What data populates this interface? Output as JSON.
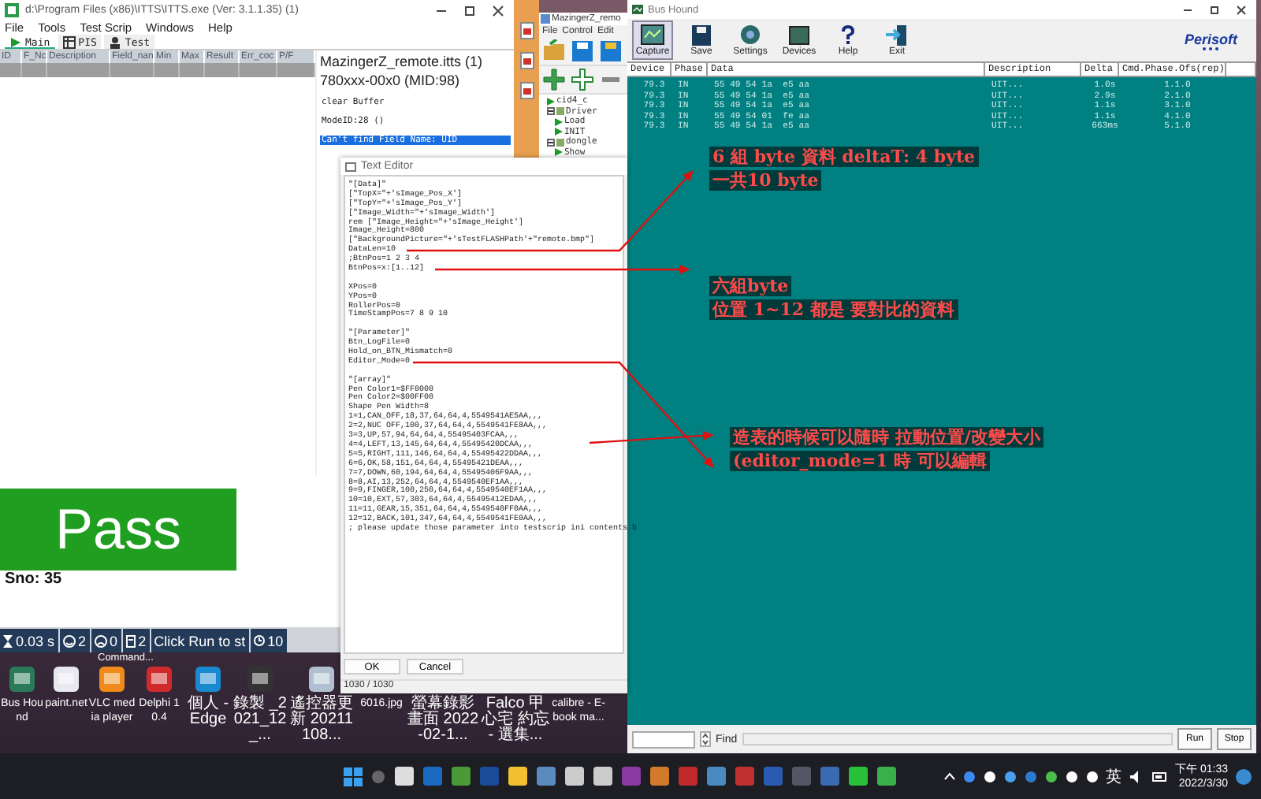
{
  "itts": {
    "title": "d:\\Program Files (x86)\\ITTS\\ITTS.exe    (Ver: 3.1.1.35) (1)",
    "menu": [
      "File",
      "Tools",
      "Test Scrip",
      "Windows",
      "Help"
    ],
    "tabs": [
      {
        "label": "Main",
        "selected": true
      },
      {
        "label": "PIS",
        "selected": false
      },
      {
        "label": "Test",
        "selected": false
      }
    ],
    "columns": [
      "ID",
      "F_Nc",
      "Description",
      "Field_nan",
      "Min",
      "Max",
      "Result",
      "Err_coc",
      "P/F"
    ],
    "script_title": "MazingerZ_remote.itts  (1)",
    "model": "780xxx-00x0 (MID:98)",
    "log": [
      {
        "text": "clear Buffer",
        "selected": false
      },
      {
        "text": "ModeID:28 ()",
        "selected": false
      },
      {
        "text": "Can't find Field Name: UID",
        "selected": true
      }
    ],
    "result": "Pass",
    "serial": "Sno: 35",
    "status": [
      {
        "kind": "timer",
        "text": "0.03 s"
      },
      {
        "kind": "smile",
        "text": "2"
      },
      {
        "kind": "frown",
        "text": "0"
      },
      {
        "kind": "doc",
        "text": "2"
      },
      {
        "kind": "plain",
        "text": "Click Run to st"
      },
      {
        "kind": "clock",
        "text": "10"
      }
    ]
  },
  "mazinger": {
    "title": "MazingerZ_remo",
    "menu": [
      "File",
      "Control",
      "Edit"
    ],
    "tree": [
      {
        "label": "cid4_c"
      },
      {
        "label": "Driver",
        "children": [
          {
            "label": "Load"
          },
          {
            "label": "INIT"
          }
        ]
      },
      {
        "label": "dongle",
        "children": [
          {
            "label": "Show"
          }
        ]
      }
    ]
  },
  "text_editor": {
    "title": "Text Editor",
    "sections": [
      [
        "\"[Data]\"",
        "[\"TopX=\"+'sImage_Pos_X']",
        "[\"TopY=\"+'sImage_Pos_Y']",
        "[\"Image_Width=\"+'sImage_Width']",
        "rem [\"Image_Height=\"+'sImage_Height']",
        "Image_Height=800",
        "[\"BackgroundPicture=\"+'sTestFLASHPath'+\"remote.bmp\"]",
        "DataLen=10",
        ";BtnPos=1 2 3 4",
        "BtnPos=x:[1..12]"
      ],
      [
        "XPos=0",
        "YPos=0",
        "RollerPos=0",
        "TimeStampPos=7 8 9 10"
      ],
      [
        "\"[Parameter]\"",
        "Btn_LogFile=0",
        "Hold_on_BTN_Mismatch=0",
        "Editor_Mode=0"
      ],
      [
        "\"[array]\"",
        "Pen Color1=$FF0000",
        "Pen Color2=$00FF00",
        "Shape Pen Width=8",
        "1=1,CAN_OFF,18,37,64,64,4,5549541AE5AA,,,",
        "2=2,NUC OFF,100,37,64,64,4,5549541FE8AA,,,",
        "3=3,UP,57,94,64,64,4,55495403FCAA,,,",
        "4=4,LEFT,13,145,64,64,4,55495420DCAA,,,",
        "5=5,RIGHT,111,146,64,64,4,55495422DDAA,,,",
        "6=6,OK,58,151,64,64,4,55495421DEAA,,,",
        "7=7,DOWN,60,194,64,64,4,55495406F9AA,,,",
        "8=8,AI,13,252,64,64,4,5549540EF1AA,,,",
        "9=9,FINGER,100,250,64,64,4,5549540EF1AA,,,",
        "10=10,EXT,57,303,64,64,4,55495412EDAA,,,",
        "11=11,GEAR,15,351,64,64,4,5549540FF0AA,,,",
        "12=12,BACK,101,347,64,64,4,5549541FE0AA,,,",
        "; please update those parameter into testscrip ini contents b"
      ]
    ],
    "buttons": [
      "OK",
      "Cancel"
    ],
    "status": "1030 / 1030"
  },
  "bus_hound": {
    "title": "Bus Hound",
    "tools": [
      {
        "label": "Capture",
        "selected": true
      },
      {
        "label": "Save",
        "selected": false
      },
      {
        "label": "Settings",
        "selected": false
      },
      {
        "label": "Devices",
        "selected": false
      },
      {
        "label": "Help",
        "selected": false
      },
      {
        "label": "Exit",
        "selected": false
      }
    ],
    "logo": "Perisoft",
    "columns": [
      "Device",
      "Phase",
      "Data",
      "Description",
      "Delta",
      "Cmd.Phase.Ofs(rep)"
    ],
    "rows": [
      [
        "79.3",
        "IN",
        "55 49 54 1a  e5 aa",
        "UIT...",
        "1.0s",
        "1.1.0"
      ],
      [
        "79.3",
        "IN",
        "55 49 54 1a  e5 aa",
        "UIT...",
        "2.9s",
        "2.1.0"
      ],
      [
        "79.3",
        "IN",
        "55 49 54 1a  e5 aa",
        "UIT...",
        "1.1s",
        "3.1.0"
      ],
      [
        "79.3",
        "IN",
        "55 49 54 01  fe aa",
        "UIT...",
        "1.1s",
        "4.1.0"
      ],
      [
        "79.3",
        "IN",
        "55 49 54 1a  e5 aa",
        "UIT...",
        "663ms",
        "5.1.0"
      ]
    ],
    "find_label": "Find",
    "buttons": [
      "Run",
      "Stop"
    ]
  },
  "annotations": [
    {
      "lines": [
        "6 組 byte 資料 deltaT: 4 byte",
        "一共10 byte"
      ]
    },
    {
      "lines": [
        "六組byte",
        "位置 1~12  都是 要對比的資料"
      ]
    },
    {
      "lines": [
        "造表的時候可以隨時 拉動位置/改變大小",
        "(editor_mode=1 時 可以編輯"
      ]
    }
  ],
  "desktop_text": "Command...",
  "desktop_icons": [
    {
      "label": "Bus Hound"
    },
    {
      "label": "paint.net"
    },
    {
      "label": "VLC media player"
    },
    {
      "label": "Delphi 10.4"
    },
    {
      "label": "個人 - Edge"
    },
    {
      "label": "錄製 _2021_12_..."
    },
    {
      "label": "遙控器更新 20211108..."
    },
    {
      "label": "6016.jpg"
    },
    {
      "label": "螢幕錄影畫面 2022-02-1..."
    },
    {
      "label": "Falco 甲心宅 約忘 - 選集..."
    },
    {
      "label": "calibre - E-book ma..."
    }
  ],
  "taskbar": {
    "ime": "英",
    "time": "下午 01:33",
    "date": "2022/3/30"
  }
}
